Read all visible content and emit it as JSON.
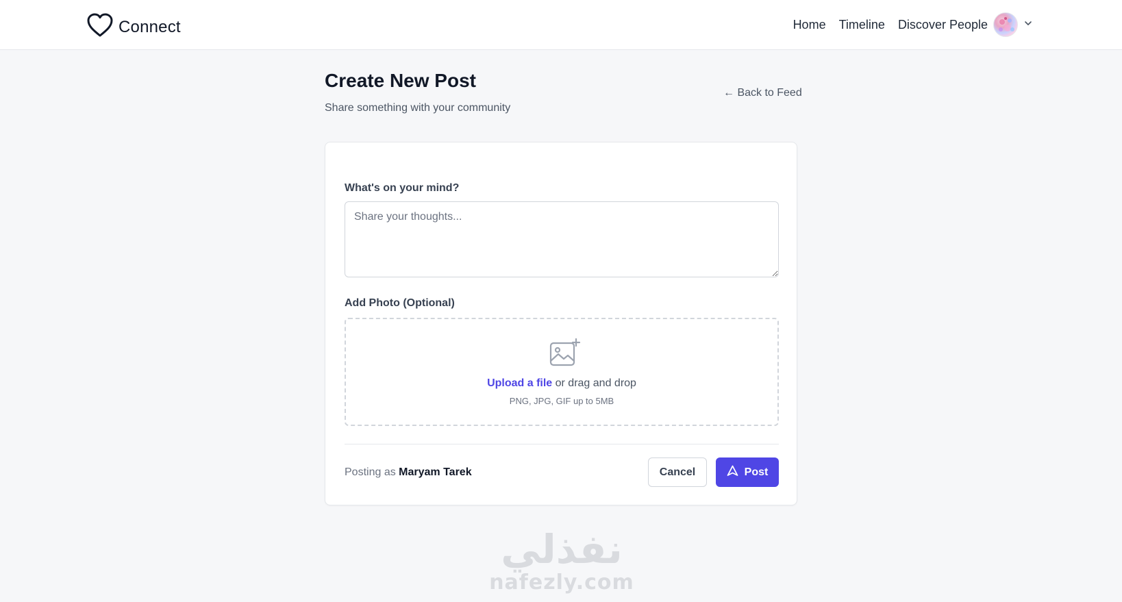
{
  "nav": {
    "brand": "Connect",
    "links": [
      "Home",
      "Timeline",
      "Discover People"
    ],
    "icons": {
      "brand": "heart-icon",
      "menu": "chevron-down-icon"
    }
  },
  "header": {
    "title": "Create New Post",
    "subtitle": "Share something with your community",
    "back": "← Back to Feed"
  },
  "form": {
    "content_label": "What's on your mind?",
    "content_placeholder": "Share your thoughts...",
    "content_value": "",
    "photo_label": "Add Photo (Optional)",
    "upload_link": "Upload a file",
    "upload_text": " or drag and drop",
    "upload_hint": "PNG, JPG, GIF up to 5MB",
    "posting_prefix": "Posting as ",
    "posting_user": "Maryam Tarek",
    "cancel": "Cancel",
    "post": "Post"
  },
  "watermark": {
    "arabic": "نفذلي",
    "latin": "nafezly.com"
  },
  "colors": {
    "accent": "#4f46e5",
    "background": "#f6f7f9",
    "card": "#ffffff"
  }
}
